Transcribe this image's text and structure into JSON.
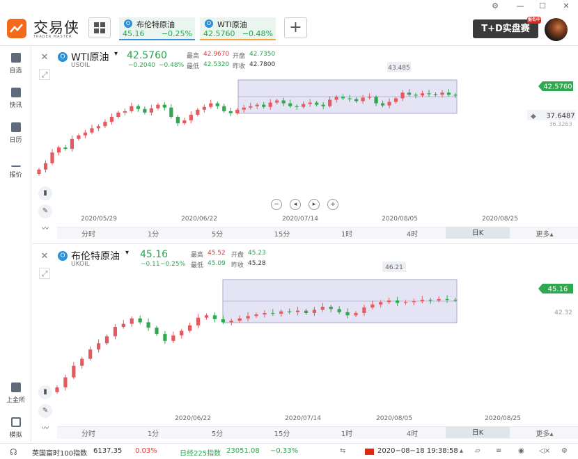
{
  "app": {
    "name": "交易侠",
    "subtitle": "TRADER MASTER"
  },
  "window_controls": [
    "⚙",
    "—",
    "☐",
    "✕"
  ],
  "tabs": [
    {
      "name": "布伦特原油",
      "price": "45.16",
      "change": "−0.25%"
    },
    {
      "name": "WTI原油",
      "price": "42.5760",
      "change": "−0.48%"
    }
  ],
  "td_button": {
    "label": "T+D实盘赛",
    "badge": "报名中"
  },
  "sidebar": [
    {
      "label": "自选",
      "icon": "bookmark-icon"
    },
    {
      "label": "快讯",
      "icon": "news-icon"
    },
    {
      "label": "日历",
      "icon": "calendar-icon"
    },
    {
      "label": "报价",
      "icon": "quote-icon"
    },
    {
      "label": "上金所",
      "icon": "exchange-icon"
    },
    {
      "label": "模拟",
      "icon": "simulate-icon"
    }
  ],
  "timeframes": [
    "分时",
    "1分",
    "5分",
    "15分",
    "1时",
    "4时",
    "日K",
    "更多▴"
  ],
  "selected_timeframe": "日K",
  "panels": [
    {
      "id": "wti",
      "name": "WTI原油",
      "code": "USOIL",
      "price": "42.5760",
      "change": "−0.2040",
      "change_pct": "−0.48%",
      "high_label": "最高",
      "high": "42.9670",
      "open_label": "开盘",
      "open": "42.7350",
      "low_label": "最低",
      "low": "42.5320",
      "prev_label": "昨收",
      "prev": "42.7800",
      "tooltip_high": "43.485",
      "price_tag": "42.5760",
      "alert_price": "37.6487",
      "alert_sub": "36.3263",
      "date_labels": [
        "2020/05/29",
        "2020/06/22",
        "2020/07/14",
        "2020/08/05",
        "2020/08/25"
      ]
    },
    {
      "id": "brent",
      "name": "布伦特原油",
      "code": "UKOIL",
      "price": "45.16",
      "change": "−0.11",
      "change_pct": "−0.25%",
      "high_label": "最高",
      "high": "45.52",
      "open_label": "开盘",
      "open": "45.23",
      "low_label": "最低",
      "low": "45.09",
      "prev_label": "昨收",
      "prev": "45.28",
      "tooltip_high": "46.21",
      "price_tag": "45.16",
      "side_label": "42.32",
      "date_labels": [
        "2020/06/22",
        "2020/07/14",
        "2020/08/05",
        "2020/08/25"
      ]
    }
  ],
  "status": {
    "idx1_name": "英国富时100指数",
    "idx1_value": "6137.35",
    "idx1_change": "0.03%",
    "idx2_name": "日经225指数",
    "idx2_value": "23051.08",
    "idx2_change": "−0.33%",
    "datetime": "2020−08−18 19:38:58"
  },
  "chart_data": [
    {
      "type": "candlestick",
      "title": "WTI原油",
      "series": [
        {
          "name": "USOIL",
          "values": [
            32.1,
            33.0,
            34.5,
            35.2,
            35.0,
            36.4,
            36.9,
            37.3,
            37.9,
            38.2,
            38.8,
            39.5,
            40.1,
            40.3,
            41.0,
            40.6,
            40.1,
            40.7,
            41.2,
            40.8,
            39.5,
            38.6,
            39.0,
            39.8,
            40.5,
            40.9,
            41.4,
            41.0,
            40.3,
            40.0,
            40.5,
            40.8,
            41.0,
            41.2,
            40.9,
            41.5,
            41.8,
            41.4,
            41.0,
            40.9,
            41.3,
            41.5,
            41.2,
            41.0,
            41.9,
            42.3,
            42.1,
            42.0,
            41.7,
            42.2,
            42.3,
            41.4,
            41.1,
            41.6,
            42.1,
            42.9,
            42.6,
            42.5,
            42.8,
            42.7,
            42.6,
            42.9,
            42.6,
            42.58
          ]
        }
      ],
      "x_ticks": [
        "2020/05/29",
        "2020/06/22",
        "2020/07/14",
        "2020/08/05",
        "2020/08/25"
      ]
    },
    {
      "type": "candlestick",
      "title": "布伦特原油",
      "series": [
        {
          "name": "UKOIL",
          "values": [
            33.9,
            35.2,
            36.7,
            37.6,
            38.8,
            39.6,
            40.5,
            41.7,
            42.1,
            42.8,
            42.3,
            41.6,
            40.8,
            39.9,
            40.6,
            41.2,
            41.9,
            42.9,
            43.2,
            42.7,
            42.3,
            42.5,
            42.8,
            43.1,
            43.3,
            43.5,
            43.4,
            43.7,
            43.6,
            43.8,
            43.5,
            43.9,
            44.3,
            44.0,
            43.6,
            43.2,
            43.5,
            44.2,
            44.6,
            44.9,
            45.1,
            44.8,
            44.9,
            45.0,
            45.2,
            45.1,
            45.3,
            45.2,
            45.16
          ]
        }
      ],
      "x_ticks": [
        "2020/06/22",
        "2020/07/14",
        "2020/08/05",
        "2020/08/25"
      ]
    }
  ]
}
